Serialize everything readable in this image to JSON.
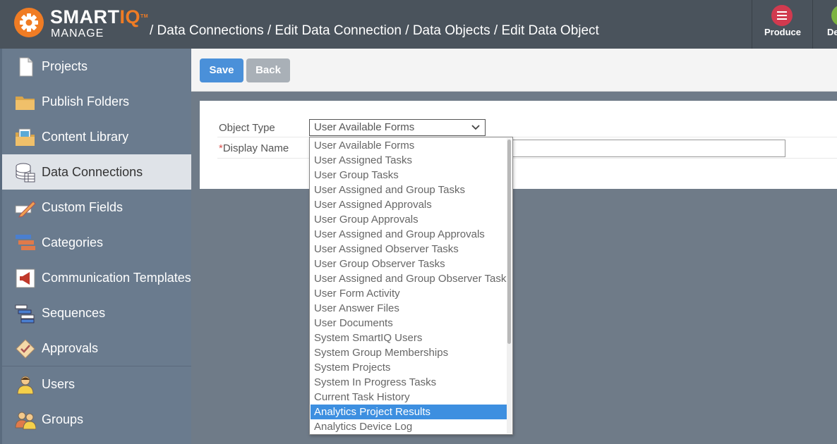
{
  "header": {
    "logo_smart": "SMART",
    "logo_iq": "IQ",
    "logo_tm": "TM",
    "logo_sub": "MANAGE",
    "breadcrumb": "/ Data Connections / Edit Data Connection / Data Objects / Edit Data Object",
    "produce_label": "Produce",
    "next_label": "De"
  },
  "sidebar": {
    "items": [
      {
        "label": "Projects",
        "icon": "document-icon"
      },
      {
        "label": "Publish Folders",
        "icon": "folder-icon"
      },
      {
        "label": "Content Library",
        "icon": "content-library-icon"
      },
      {
        "label": "Data Connections",
        "icon": "database-icon"
      },
      {
        "label": "Custom Fields",
        "icon": "pencil-field-icon"
      },
      {
        "label": "Categories",
        "icon": "categories-icon"
      },
      {
        "label": "Communication Templates",
        "icon": "megaphone-icon"
      },
      {
        "label": "Sequences",
        "icon": "sequences-icon"
      },
      {
        "label": "Approvals",
        "icon": "approval-icon"
      },
      {
        "label": "Users",
        "icon": "user-icon"
      },
      {
        "label": "Groups",
        "icon": "group-icon"
      }
    ],
    "active": "Data Connections"
  },
  "toolbar": {
    "save_label": "Save",
    "back_label": "Back"
  },
  "form": {
    "object_type_label": "Object Type",
    "object_type_value": "User Available Forms",
    "display_name_required": "*",
    "display_name_label": "Display Name",
    "display_name_value": ""
  },
  "dropdown": {
    "options": [
      "User Available Forms",
      "User Assigned Tasks",
      "User Group Tasks",
      "User Assigned and Group Tasks",
      "User Assigned Approvals",
      "User Group Approvals",
      "User Assigned and Group Approvals",
      "User Assigned Observer Tasks",
      "User Group Observer Tasks",
      "User Assigned and Group Observer Tasks",
      "User Form Activity",
      "User Answer Files",
      "User Documents",
      "System SmartIQ Users",
      "System Group Memberships",
      "System Projects",
      "System In Progress Tasks",
      "Current Task History",
      "Analytics Project Results",
      "Analytics Device Log"
    ],
    "highlighted": "Analytics Project Results"
  },
  "colors": {
    "header_bg": "#4a535c",
    "brand_orange": "#f07c24",
    "sidebar_bg": "#6a7b8e",
    "save_blue": "#4a90d9",
    "highlight_blue": "#3d8fe0"
  }
}
